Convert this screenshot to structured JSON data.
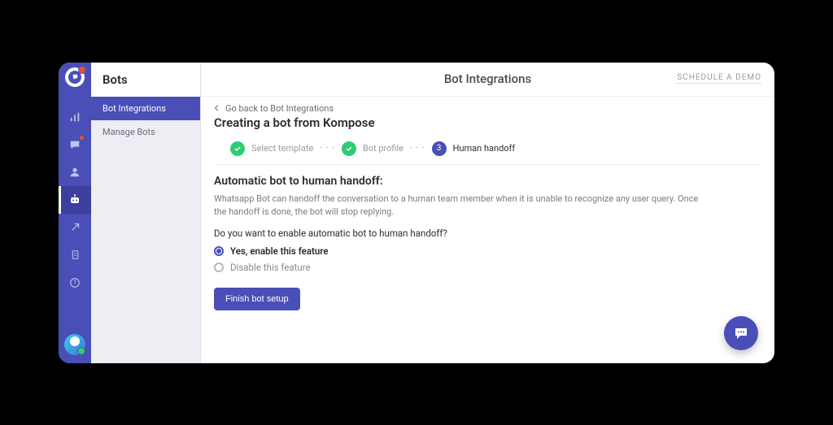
{
  "secondary_sidebar": {
    "title": "Bots",
    "items": [
      {
        "label": "Bot Integrations",
        "active": true
      },
      {
        "label": "Manage Bots",
        "active": false
      }
    ]
  },
  "main": {
    "header_title": "Bot Integrations",
    "schedule_label": "SCHEDULE A DEMO",
    "back_label": "Go back to Bot Integrations",
    "page_subtitle": "Creating a bot from Kompose",
    "stepper": [
      {
        "label": "Select template",
        "state": "done"
      },
      {
        "label": "Bot profile",
        "state": "done"
      },
      {
        "label": "Human handoff",
        "state": "current",
        "num": "3"
      }
    ],
    "section_heading": "Automatic bot to human handoff:",
    "help_text": "Whatsapp Bot can handoff the conversation to a human team member when it is unable to recognize any user query. Once the handoff is done, the bot will stop replying.",
    "question": "Do you want to enable automatic bot to human handoff?",
    "options": {
      "enable": "Yes, enable this feature",
      "disable": "Disable this feature"
    },
    "finish_button": "Finish bot setup"
  }
}
